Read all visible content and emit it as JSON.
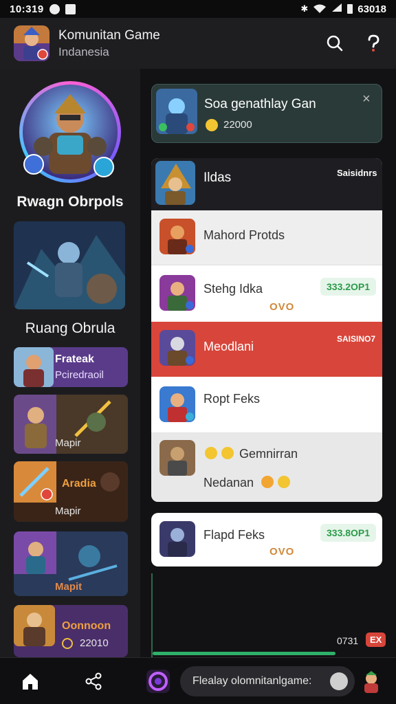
{
  "status_bar": {
    "time": "10:319",
    "battery": "63018",
    "icons": [
      "whatsapp-icon",
      "gallery-icon",
      "bluetooth-icon",
      "wifi-icon",
      "signal-icon",
      "battery-icon"
    ]
  },
  "header": {
    "title": "Komunitan Game",
    "subtitle": "Indanesia",
    "search_icon": "search-icon",
    "help_icon": "help-icon"
  },
  "left": {
    "featured_label": "Rwagn Obrpols",
    "room_label": "Ruang Obrula",
    "tiles": [
      {
        "title": "Frateak",
        "subtitle": "Pciredraoil"
      },
      {
        "title": "Mapir"
      },
      {
        "title": "Aradia",
        "subtitle": "Mapir"
      },
      {
        "title": "Mapit"
      },
      {
        "title": "Oonnoon",
        "value": "22010"
      }
    ]
  },
  "right": {
    "notification": {
      "title": "Soa genathlay Gan",
      "value": "22000"
    },
    "list_header": {
      "title": "Ildas",
      "action": "Saisidnrs"
    },
    "rows": [
      {
        "title": "Mahord Protds"
      },
      {
        "title": "Stehg Idka",
        "badge": "333.2OP1",
        "sub": "OVO"
      },
      {
        "title": "Meodlani",
        "badge": "SAISINO7"
      },
      {
        "title": "Ropt Feks"
      },
      {
        "title": "Gemnirran",
        "sub": "Nedanan"
      }
    ],
    "card": {
      "title": "Flapd Feks",
      "badge": "333.8OP1",
      "sub": "OVO"
    },
    "footer": {
      "count": "0731",
      "tag": "EX"
    }
  },
  "bottom_nav": {
    "chat_placeholder": "Flealay olomnitanlgame:",
    "icons": [
      "home-icon",
      "share-icon",
      "game-ring-icon",
      "user-icon",
      "avatar-icon"
    ]
  },
  "colors": {
    "accent_red": "#d8453a",
    "green": "#2c9a4a",
    "panel_bg": "#121214",
    "sidebar_bg": "#1c1c1f"
  }
}
